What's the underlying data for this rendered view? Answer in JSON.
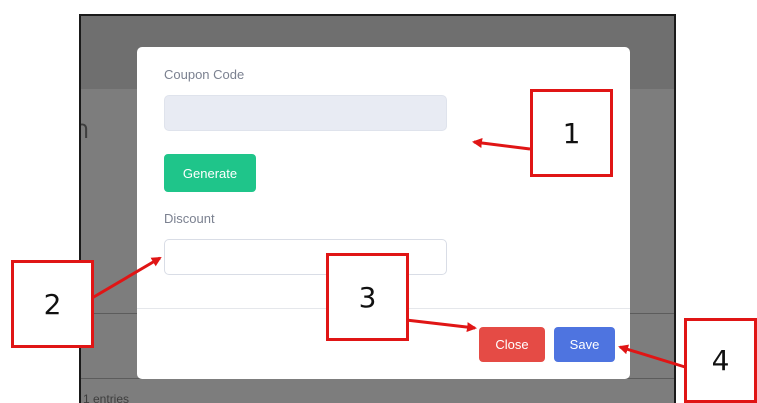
{
  "background_page": {
    "heading_fragment": "ำ",
    "footer_text": "1 entries"
  },
  "modal": {
    "coupon_label": "Coupon Code",
    "coupon_value": "",
    "generate_label": "Generate",
    "discount_label": "Discount",
    "discount_value": "",
    "close_label": "Close",
    "save_label": "Save"
  },
  "annotations": {
    "callout_1": "1",
    "callout_2": "2",
    "callout_3": "3",
    "callout_4": "4"
  },
  "colors": {
    "generate_button": "#1fc58a",
    "close_button": "#e54b45",
    "save_button": "#4e74e0",
    "callout_border": "#e01515"
  }
}
